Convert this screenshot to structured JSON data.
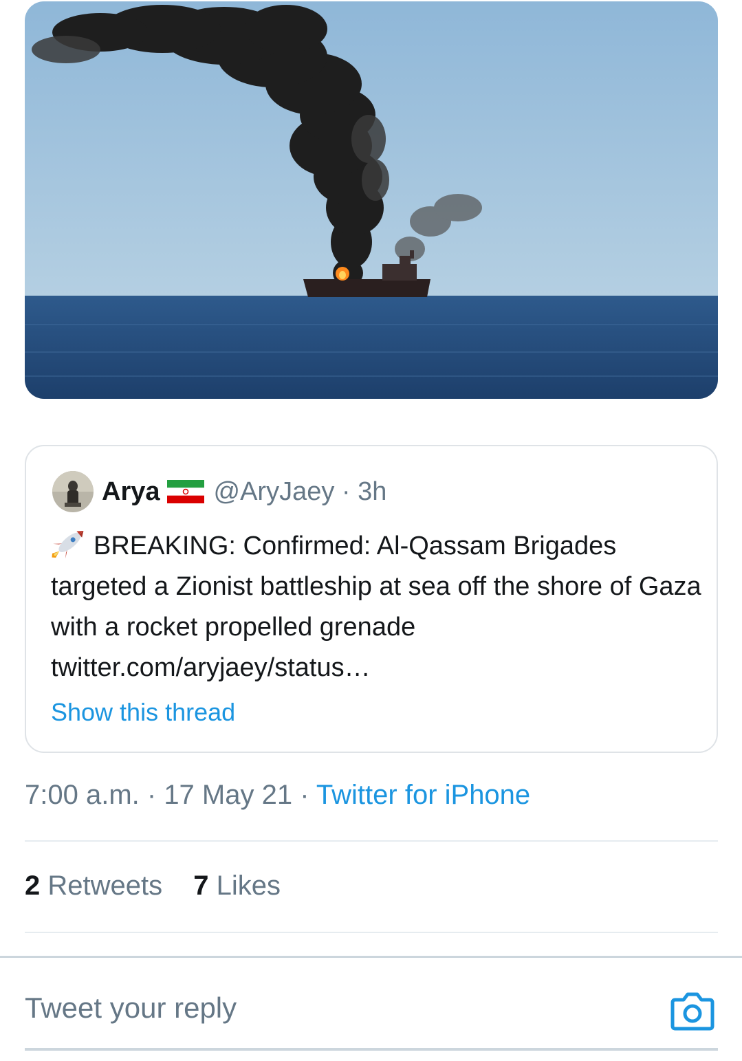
{
  "media": {
    "icon": "tanker-fire-image"
  },
  "quote": {
    "author_name": "Arya",
    "flag_icon": "iran-flag-icon",
    "handle": "@AryJaey",
    "time_ago": "3h",
    "text_icon": "rocket-icon",
    "text": "BREAKING: Confirmed: Al-Qassam Brigades targeted a Zionist battleship at sea off the shore of Gaza with a rocket propelled grenade twitter.com/aryjaey/status…",
    "show_thread": "Show this thread"
  },
  "timestamp": {
    "time": "7:00 a.m.",
    "date": "17 May 21",
    "source": "Twitter for iPhone"
  },
  "stats": {
    "retweets_count": "2",
    "retweets_label": "Retweets",
    "likes_count": "7",
    "likes_label": "Likes"
  },
  "reply": {
    "placeholder": "Tweet your reply",
    "camera_icon": "camera-icon"
  },
  "colors": {
    "link": "#1b95e0",
    "secondary_text": "#657786",
    "primary_text": "#14171a"
  }
}
